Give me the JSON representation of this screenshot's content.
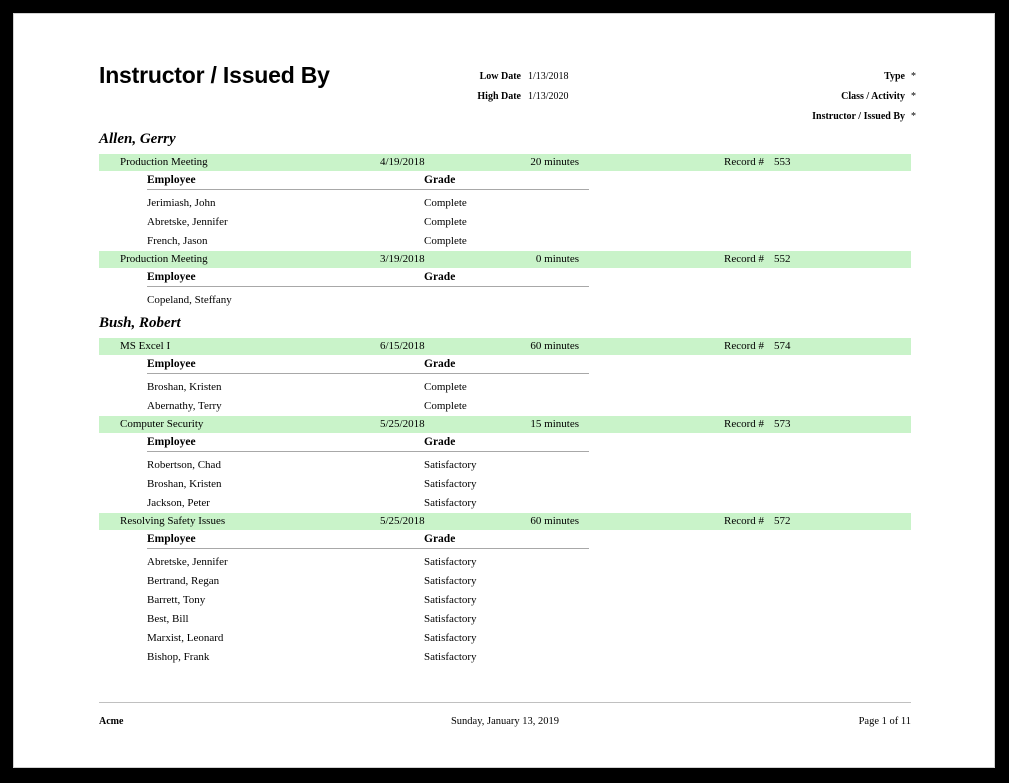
{
  "report": {
    "title": "Instructor / Issued By",
    "parameters_left": [
      {
        "label": "Low Date",
        "value": "1/13/2018"
      },
      {
        "label": "High Date",
        "value": "1/13/2020"
      }
    ],
    "parameters_right": [
      {
        "label": "Type",
        "value": "*"
      },
      {
        "label": "Class / Activity",
        "value": "*"
      },
      {
        "label": "Instructor / Issued By",
        "value": "*"
      }
    ],
    "columns": {
      "employee": "Employee",
      "grade": "Grade"
    },
    "record_label": "Record #",
    "accent_color": "#c9f3c9",
    "groups": [
      {
        "instructor": "Allen, Gerry",
        "records": [
          {
            "class": "Production Meeting",
            "date": "4/19/2018",
            "duration": "20 minutes",
            "record_number": "553",
            "employees": [
              {
                "name": "Jerimiash, John",
                "grade": "Complete"
              },
              {
                "name": "Abretske, Jennifer",
                "grade": "Complete"
              },
              {
                "name": "French, Jason",
                "grade": "Complete"
              }
            ]
          },
          {
            "class": "Production Meeting",
            "date": "3/19/2018",
            "duration": "0 minutes",
            "record_number": "552",
            "employees": [
              {
                "name": "Copeland, Steffany",
                "grade": ""
              }
            ]
          }
        ]
      },
      {
        "instructor": "Bush, Robert",
        "records": [
          {
            "class": "MS Excel I",
            "date": "6/15/2018",
            "duration": "60 minutes",
            "record_number": "574",
            "employees": [
              {
                "name": "Broshan, Kristen",
                "grade": "Complete"
              },
              {
                "name": "Abernathy, Terry",
                "grade": "Complete"
              }
            ]
          },
          {
            "class": "Computer Security",
            "date": "5/25/2018",
            "duration": "15 minutes",
            "record_number": "573",
            "employees": [
              {
                "name": "Robertson, Chad",
                "grade": "Satisfactory"
              },
              {
                "name": "Broshan, Kristen",
                "grade": "Satisfactory"
              },
              {
                "name": "Jackson, Peter",
                "grade": "Satisfactory"
              }
            ]
          },
          {
            "class": "Resolving Safety Issues",
            "date": "5/25/2018",
            "duration": "60 minutes",
            "record_number": "572",
            "employees": [
              {
                "name": "Abretske, Jennifer",
                "grade": "Satisfactory"
              },
              {
                "name": "Bertrand, Regan",
                "grade": "Satisfactory"
              },
              {
                "name": "Barrett, Tony",
                "grade": "Satisfactory"
              },
              {
                "name": "Best, Bill",
                "grade": "Satisfactory"
              },
              {
                "name": "Marxist, Leonard",
                "grade": "Satisfactory"
              },
              {
                "name": "Bishop, Frank",
                "grade": "Satisfactory"
              }
            ]
          }
        ]
      }
    ],
    "footer": {
      "company": "Acme",
      "date": "Sunday, January 13, 2019",
      "page": "Page 1 of 11"
    }
  }
}
